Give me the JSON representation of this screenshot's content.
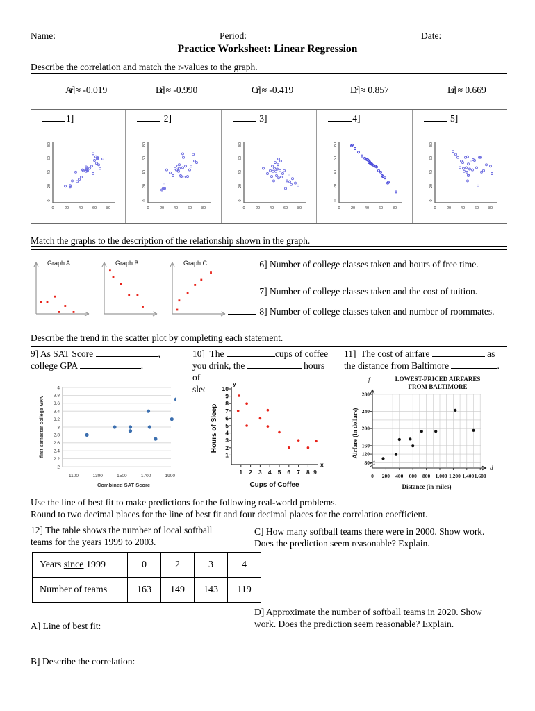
{
  "header": {
    "name_label": "Name:",
    "period_label": "Period:",
    "date_label": "Date:",
    "title": "Practice Worksheet: Linear Regression"
  },
  "section1": {
    "instruction": "Describe the correlation and match the r-values to the graph.",
    "r_values": [
      {
        "letter": "A]",
        "value": "r ≈ -0.019"
      },
      {
        "letter": "B]",
        "value": "r ≈ -0.990"
      },
      {
        "letter": "C]",
        "value": "r ≈ -0.419"
      },
      {
        "letter": "D]",
        "value": "r ≈ 0.857"
      },
      {
        "letter": "E]",
        "value": "r ≈ 0.669"
      }
    ],
    "panels": [
      {
        "number": "1]"
      },
      {
        "number": "2]"
      },
      {
        "number": "3]"
      },
      {
        "number": "4]"
      },
      {
        "number": "5]"
      }
    ]
  },
  "section2": {
    "instruction": "Match the graphs to the description of the relationship shown in the graph.",
    "graphs": [
      {
        "label": "Graph A"
      },
      {
        "label": "Graph B"
      },
      {
        "label": "Graph C"
      }
    ],
    "questions": [
      {
        "number": "6]",
        "text": "Number of college classes taken and hours of free time."
      },
      {
        "number": "7]",
        "text": "Number of college classes taken and the cost of tuition."
      },
      {
        "number": "8]",
        "text": "Number of college classes taken and number of roommates."
      }
    ]
  },
  "section3": {
    "instruction": "Describe the trend in the scatter plot by completing each statement.",
    "q9": {
      "number": "9]",
      "line1_a": "As SAT Score",
      "line1_b": ",",
      "line2_a": "college GPA",
      "line2_b": "."
    },
    "q10": {
      "number": "10]",
      "line1_a": "The",
      "line1_b": "cups of coffee",
      "line2_a": "you drink, the",
      "line2_b": "hours of",
      "line3": "sleep you get."
    },
    "q11": {
      "number": "11]",
      "line1_a": "The cost of airfare",
      "line1_b": "as",
      "line2_a": "the distance from Baltimore",
      "line2_b": "."
    }
  },
  "section4": {
    "instruction_line1": "Use the line of best fit to make predictions for the following real-world problems.",
    "instruction_line2": "Round to two decimal places for the line of best fit and four decimal places for the correlation coefficient.",
    "q12_line1": "12]  The table shows the number of local softball",
    "q12_line2": "teams for the years 1999 to 2003.",
    "table": {
      "row1_header_a": "Years ",
      "row1_header_b": "since",
      "row1_header_c": " 1999",
      "row1_values": [
        "0",
        "2",
        "3",
        "4"
      ],
      "row2_header": "Number of teams",
      "row2_values": [
        "163",
        "149",
        "143",
        "119"
      ]
    },
    "part_a": "A]  Line of best fit:",
    "part_b": "B]  Describe the correlation:",
    "part_c_line1": "C]  How many softball teams there were in 2000.  Show work.",
    "part_c_line2": "Does the prediction seem reasonable?  Explain.",
    "part_d_line1": "D]  Approximate the number of softball teams in 2020.  Show",
    "part_d_line2": "work. Does the prediction seem reasonable?  Explain."
  },
  "colors": {
    "scatter_blue": "#6B6BE0",
    "scatter_red": "#E8231A",
    "excel_blue": "#3C6FAF",
    "axis_gray": "#868686",
    "grid_gray": "#C8C8C8"
  },
  "chart_data": [
    {
      "id": "panel1",
      "type": "scatter",
      "title": "1]",
      "xlim": [
        0,
        90
      ],
      "ylim": [
        0,
        90
      ],
      "xticks": [
        0,
        20,
        40,
        60,
        80
      ],
      "yticks": [
        0,
        20,
        40,
        60,
        80
      ],
      "correlation_hint": "strong positive",
      "points": [
        [
          18,
          24
        ],
        [
          25,
          23
        ],
        [
          25,
          25
        ],
        [
          28,
          31
        ],
        [
          33,
          43
        ],
        [
          35,
          30
        ],
        [
          38,
          33
        ],
        [
          41,
          36
        ],
        [
          43,
          46
        ],
        [
          44,
          45
        ],
        [
          48,
          44
        ],
        [
          48,
          50
        ],
        [
          49,
          46
        ],
        [
          49,
          47
        ],
        [
          50,
          45
        ],
        [
          53,
          48
        ],
        [
          56,
          51
        ],
        [
          58,
          68
        ],
        [
          58,
          41
        ],
        [
          60,
          58
        ],
        [
          62,
          63
        ],
        [
          63,
          54
        ],
        [
          64,
          62
        ],
        [
          64,
          60
        ],
        [
          65,
          61
        ],
        [
          66,
          52
        ],
        [
          68,
          47
        ],
        [
          72,
          60
        ]
      ]
    },
    {
      "id": "panel2",
      "type": "scatter",
      "title": "2]",
      "xlim": [
        0,
        90
      ],
      "ylim": [
        0,
        90
      ],
      "xticks": [
        0,
        20,
        40,
        60,
        80
      ],
      "yticks": [
        0,
        20,
        40,
        60,
        80
      ],
      "correlation_hint": "weak positive",
      "points": [
        [
          20,
          18
        ],
        [
          22,
          20
        ],
        [
          23,
          26
        ],
        [
          24,
          20
        ],
        [
          27,
          45
        ],
        [
          32,
          41
        ],
        [
          36,
          37
        ],
        [
          39,
          47
        ],
        [
          41,
          45
        ],
        [
          42,
          45
        ],
        [
          43,
          50
        ],
        [
          44,
          43
        ],
        [
          45,
          52
        ],
        [
          45,
          47
        ],
        [
          46,
          36
        ],
        [
          47,
          38
        ],
        [
          48,
          37
        ],
        [
          50,
          69
        ],
        [
          50,
          48
        ],
        [
          51,
          62
        ],
        [
          52,
          36
        ],
        [
          54,
          52
        ],
        [
          57,
          37
        ],
        [
          60,
          45
        ],
        [
          62,
          52
        ],
        [
          65,
          68
        ],
        [
          67,
          59
        ],
        [
          70,
          57
        ]
      ]
    },
    {
      "id": "panel3",
      "type": "scatter",
      "title": "3]",
      "xlim": [
        0,
        90
      ],
      "ylim": [
        0,
        90
      ],
      "xticks": [
        0,
        20,
        40,
        60,
        80
      ],
      "yticks": [
        0,
        20,
        40,
        60,
        80
      ],
      "correlation_hint": "weak negative",
      "points": [
        [
          28,
          47
        ],
        [
          34,
          40
        ],
        [
          38,
          44
        ],
        [
          40,
          36
        ],
        [
          41,
          50
        ],
        [
          42,
          43
        ],
        [
          43,
          30
        ],
        [
          44,
          47
        ],
        [
          45,
          55
        ],
        [
          46,
          43
        ],
        [
          47,
          38
        ],
        [
          48,
          46
        ],
        [
          49,
          52
        ],
        [
          50,
          60
        ],
        [
          50,
          34
        ],
        [
          52,
          44
        ],
        [
          53,
          57
        ],
        [
          54,
          35
        ],
        [
          56,
          40
        ],
        [
          58,
          44
        ],
        [
          60,
          20
        ],
        [
          62,
          30
        ],
        [
          65,
          37
        ],
        [
          66,
          28
        ],
        [
          68,
          24
        ],
        [
          70,
          32
        ],
        [
          74,
          26
        ],
        [
          78,
          22
        ]
      ]
    },
    {
      "id": "panel4",
      "type": "scatter",
      "title": "4]",
      "xlim": [
        0,
        90
      ],
      "ylim": [
        0,
        90
      ],
      "xticks": [
        0,
        20,
        40,
        60,
        80
      ],
      "yticks": [
        0,
        20,
        40,
        60,
        80
      ],
      "correlation_hint": "very strong negative",
      "points": [
        [
          18,
          79
        ],
        [
          19,
          80
        ],
        [
          23,
          75
        ],
        [
          28,
          70
        ],
        [
          33,
          65
        ],
        [
          37,
          62
        ],
        [
          40,
          60
        ],
        [
          41,
          60
        ],
        [
          42,
          59
        ],
        [
          43,
          58
        ],
        [
          43,
          56
        ],
        [
          44,
          57
        ],
        [
          45,
          55
        ],
        [
          46,
          54
        ],
        [
          47,
          54
        ],
        [
          48,
          53
        ],
        [
          50,
          52
        ],
        [
          52,
          51
        ],
        [
          53,
          51
        ],
        [
          54,
          50
        ],
        [
          57,
          45
        ],
        [
          60,
          43
        ],
        [
          62,
          38
        ],
        [
          63,
          37
        ],
        [
          66,
          35
        ],
        [
          70,
          28
        ],
        [
          71,
          29
        ],
        [
          82,
          15
        ]
      ]
    },
    {
      "id": "panel5",
      "type": "scatter",
      "title": "5]",
      "xlim": [
        0,
        90
      ],
      "ylim": [
        0,
        90
      ],
      "xticks": [
        0,
        20,
        40,
        60,
        80
      ],
      "yticks": [
        0,
        20,
        40,
        60,
        80
      ],
      "correlation_hint": "weak negative / scattered",
      "points": [
        [
          26,
          70
        ],
        [
          30,
          66
        ],
        [
          33,
          62
        ],
        [
          36,
          48
        ],
        [
          38,
          57
        ],
        [
          40,
          55
        ],
        [
          41,
          47
        ],
        [
          42,
          43
        ],
        [
          44,
          62
        ],
        [
          45,
          48
        ],
        [
          46,
          42
        ],
        [
          47,
          63
        ],
        [
          47,
          30
        ],
        [
          48,
          53
        ],
        [
          48,
          38
        ],
        [
          48,
          37
        ],
        [
          50,
          46
        ],
        [
          52,
          57
        ],
        [
          54,
          45
        ],
        [
          55,
          60
        ],
        [
          57,
          59
        ],
        [
          60,
          48
        ],
        [
          62,
          23
        ],
        [
          64,
          62
        ],
        [
          66,
          62
        ],
        [
          67,
          42
        ],
        [
          70,
          44
        ],
        [
          74,
          52
        ],
        [
          80,
          50
        ],
        [
          82,
          39
        ]
      ]
    },
    {
      "id": "graphA",
      "type": "scatter",
      "title": "Graph A",
      "correlation_hint": "no correlation",
      "points": [
        [
          0.1,
          0.22
        ],
        [
          0.22,
          0.22
        ],
        [
          0.36,
          0.32
        ],
        [
          0.56,
          0.14
        ],
        [
          0.44,
          0.02
        ],
        [
          0.72,
          0.02
        ]
      ]
    },
    {
      "id": "graphB",
      "type": "scatter",
      "title": "Graph B",
      "correlation_hint": "negative correlation",
      "points": [
        [
          0.12,
          0.88
        ],
        [
          0.18,
          0.76
        ],
        [
          0.3,
          0.62
        ],
        [
          0.46,
          0.4
        ],
        [
          0.62,
          0.4
        ],
        [
          0.72,
          0.18
        ]
      ]
    },
    {
      "id": "graphC",
      "type": "scatter",
      "title": "Graph C",
      "correlation_hint": "positive correlation",
      "points": [
        [
          0.1,
          0.08
        ],
        [
          0.14,
          0.26
        ],
        [
          0.3,
          0.4
        ],
        [
          0.44,
          0.56
        ],
        [
          0.56,
          0.66
        ],
        [
          0.74,
          0.8
        ]
      ]
    },
    {
      "id": "sat-gpa",
      "type": "scatter",
      "title": "",
      "xlabel": "Combined SAT Score",
      "ylabel": "first semester college GPA",
      "xlim": [
        1100,
        2000
      ],
      "ylim": [
        2,
        4
      ],
      "xticks": [
        1100,
        1300,
        1500,
        1700,
        1900
      ],
      "yticks": [
        2,
        2.2,
        2.4,
        2.6,
        2.8,
        3,
        3.2,
        3.4,
        3.6,
        3.8,
        4
      ],
      "grid": true,
      "points": [
        [
          1210,
          2.8
        ],
        [
          1440,
          3.0
        ],
        [
          1570,
          3.0
        ],
        [
          1570,
          2.9
        ],
        [
          1720,
          3.4
        ],
        [
          1730,
          3.0
        ],
        [
          1780,
          2.7
        ],
        [
          1915,
          3.2
        ],
        [
          1950,
          3.7
        ]
      ]
    },
    {
      "id": "coffee-sleep",
      "type": "scatter",
      "title": "",
      "xlabel": "Cups of Coffee",
      "ylabel": "Hours of Sleep",
      "x_axis_letter": "x",
      "y_axis_letter": "y",
      "xlim": [
        0,
        9.6
      ],
      "ylim": [
        0,
        10
      ],
      "xticks": [
        1,
        2,
        3,
        4,
        5,
        6,
        7,
        8,
        9
      ],
      "yticks": [
        1,
        2,
        3,
        4,
        5,
        6,
        7,
        8,
        9,
        10
      ],
      "points": [
        [
          0.8,
          9.1
        ],
        [
          0.7,
          7.0
        ],
        [
          1.6,
          8.1
        ],
        [
          1.6,
          5.0
        ],
        [
          3.0,
          6.0
        ],
        [
          3.8,
          7.1
        ],
        [
          3.8,
          4.9
        ],
        [
          5.0,
          4.1
        ],
        [
          6.0,
          2.0
        ],
        [
          7.0,
          3.0
        ],
        [
          8.0,
          2.0
        ],
        [
          8.9,
          2.9
        ]
      ]
    },
    {
      "id": "airfare",
      "type": "scatter",
      "title_line1": "LOWEST-PRICED AIRFARES",
      "title_line2": "FROM BALTIMORE",
      "xlabel": "Distance (in miles)",
      "ylabel": "Airfare (in dollars)",
      "x_axis_letter": "d",
      "y_axis_letter": "f",
      "xlim": [
        0,
        1700
      ],
      "ylim": [
        40,
        300
      ],
      "xticks": [
        200,
        400,
        600,
        800,
        1000,
        1200,
        1400,
        1600
      ],
      "xticklabels": [
        "200",
        "400",
        "600",
        "800",
        "1,000",
        "1,200",
        "1,400",
        "1,600"
      ],
      "yticks": [
        80,
        120,
        160,
        200,
        240,
        280
      ],
      "origin_label": "0",
      "grid": true,
      "points": [
        [
          160,
          108
        ],
        [
          350,
          127
        ],
        [
          400,
          162
        ],
        [
          560,
          163
        ],
        [
          600,
          147
        ],
        [
          730,
          181
        ],
        [
          940,
          181
        ],
        [
          1230,
          263
        ],
        [
          1500,
          216
        ]
      ]
    }
  ]
}
